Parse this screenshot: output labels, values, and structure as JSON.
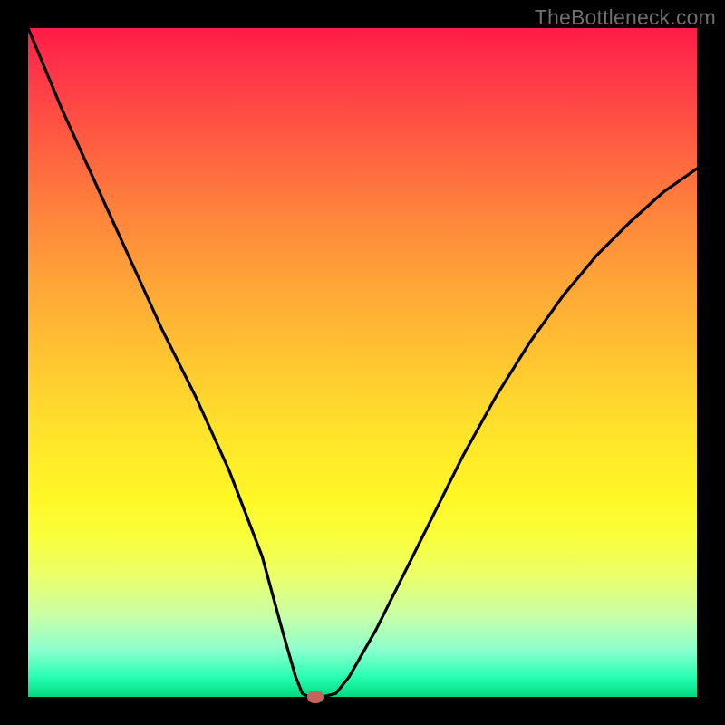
{
  "watermark": "TheBottleneck.com",
  "colors": {
    "frame": "#000000",
    "curve_stroke": "#000000",
    "dot_fill": "#c4645a"
  },
  "chart_data": {
    "type": "line",
    "title": "",
    "xlabel": "",
    "ylabel": "",
    "xlim": [
      0,
      100
    ],
    "ylim": [
      0,
      100
    ],
    "grid": false,
    "legend": false,
    "series": [
      {
        "name": "bottleneck-curve",
        "x": [
          0,
          5,
          10,
          15,
          20,
          25,
          30,
          35,
          38,
          40,
          41,
          42,
          44,
          46,
          48,
          52,
          56,
          60,
          65,
          70,
          75,
          80,
          85,
          90,
          95,
          100
        ],
        "values": [
          100,
          88,
          77,
          66,
          55,
          45,
          34,
          21,
          10,
          3,
          0.5,
          0,
          0,
          0.5,
          3,
          10,
          18,
          26,
          36,
          45,
          53,
          60,
          66,
          71,
          75.5,
          79
        ]
      }
    ],
    "annotations": [
      {
        "name": "minimum-marker",
        "x": 43,
        "y": 0
      }
    ],
    "gradient_stops": [
      {
        "pos": 0,
        "color": "#ff1a47"
      },
      {
        "pos": 25,
        "color": "#ff7a3d"
      },
      {
        "pos": 50,
        "color": "#ffc132"
      },
      {
        "pos": 75,
        "color": "#f9ff3a"
      },
      {
        "pos": 100,
        "color": "#00d980"
      }
    ]
  }
}
